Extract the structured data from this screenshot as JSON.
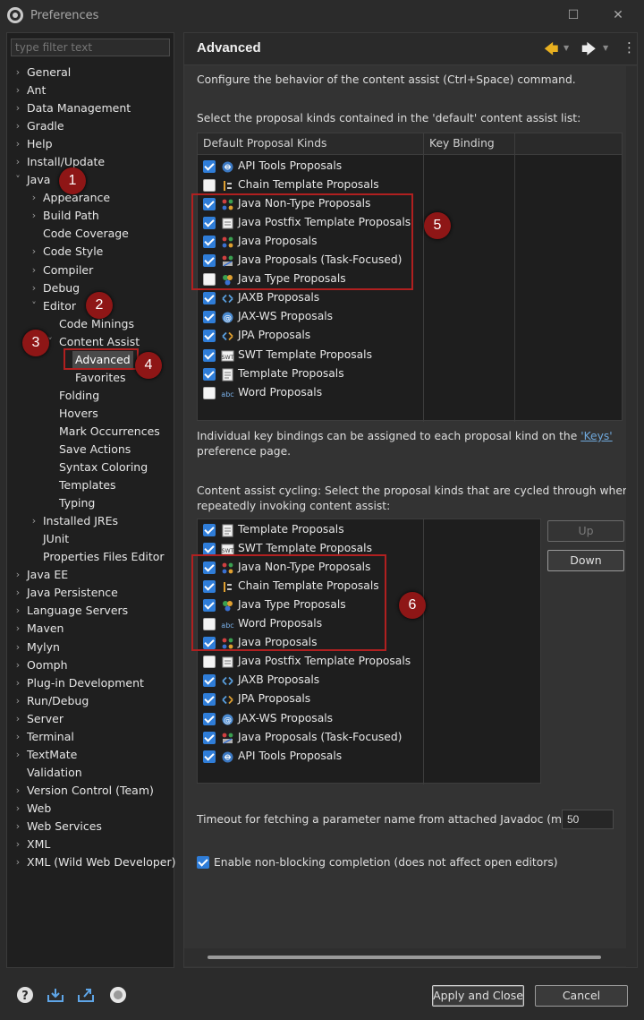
{
  "window": {
    "title": "Preferences",
    "maximize_glyph": "☐",
    "close_glyph": "✕"
  },
  "filter": {
    "placeholder": "type filter text"
  },
  "tree": [
    {
      "label": "General",
      "level": 0,
      "chevron": ">",
      "selected": false
    },
    {
      "label": "Ant",
      "level": 0,
      "chevron": ">",
      "selected": false
    },
    {
      "label": "Data Management",
      "level": 0,
      "chevron": ">",
      "selected": false
    },
    {
      "label": "Gradle",
      "level": 0,
      "chevron": ">",
      "selected": false
    },
    {
      "label": "Help",
      "level": 0,
      "chevron": ">",
      "selected": false
    },
    {
      "label": "Install/Update",
      "level": 0,
      "chevron": ">",
      "selected": false
    },
    {
      "label": "Java",
      "level": 0,
      "chevron": "v",
      "selected": false
    },
    {
      "label": "Appearance",
      "level": 1,
      "chevron": ">",
      "selected": false
    },
    {
      "label": "Build Path",
      "level": 1,
      "chevron": ">",
      "selected": false
    },
    {
      "label": "Code Coverage",
      "level": 1,
      "chevron": "",
      "selected": false
    },
    {
      "label": "Code Style",
      "level": 1,
      "chevron": ">",
      "selected": false
    },
    {
      "label": "Compiler",
      "level": 1,
      "chevron": ">",
      "selected": false
    },
    {
      "label": "Debug",
      "level": 1,
      "chevron": ">",
      "selected": false
    },
    {
      "label": "Editor",
      "level": 1,
      "chevron": "v",
      "selected": false
    },
    {
      "label": "Code Minings",
      "level": 2,
      "chevron": "",
      "selected": false
    },
    {
      "label": "Content Assist",
      "level": 2,
      "chevron": "v",
      "selected": false
    },
    {
      "label": "Advanced",
      "level": 3,
      "chevron": "",
      "selected": true
    },
    {
      "label": "Favorites",
      "level": 3,
      "chevron": "",
      "selected": false
    },
    {
      "label": "Folding",
      "level": 2,
      "chevron": "",
      "selected": false
    },
    {
      "label": "Hovers",
      "level": 2,
      "chevron": "",
      "selected": false
    },
    {
      "label": "Mark Occurrences",
      "level": 2,
      "chevron": "",
      "selected": false
    },
    {
      "label": "Save Actions",
      "level": 2,
      "chevron": "",
      "selected": false
    },
    {
      "label": "Syntax Coloring",
      "level": 2,
      "chevron": "",
      "selected": false
    },
    {
      "label": "Templates",
      "level": 2,
      "chevron": "",
      "selected": false
    },
    {
      "label": "Typing",
      "level": 2,
      "chevron": "",
      "selected": false
    },
    {
      "label": "Installed JREs",
      "level": 1,
      "chevron": ">",
      "selected": false
    },
    {
      "label": "JUnit",
      "level": 1,
      "chevron": "",
      "selected": false
    },
    {
      "label": "Properties Files Editor",
      "level": 1,
      "chevron": "",
      "selected": false
    },
    {
      "label": "Java EE",
      "level": 0,
      "chevron": ">",
      "selected": false
    },
    {
      "label": "Java Persistence",
      "level": 0,
      "chevron": ">",
      "selected": false
    },
    {
      "label": "Language Servers",
      "level": 0,
      "chevron": ">",
      "selected": false
    },
    {
      "label": "Maven",
      "level": 0,
      "chevron": ">",
      "selected": false
    },
    {
      "label": "Mylyn",
      "level": 0,
      "chevron": ">",
      "selected": false
    },
    {
      "label": "Oomph",
      "level": 0,
      "chevron": ">",
      "selected": false
    },
    {
      "label": "Plug-in Development",
      "level": 0,
      "chevron": ">",
      "selected": false
    },
    {
      "label": "Run/Debug",
      "level": 0,
      "chevron": ">",
      "selected": false
    },
    {
      "label": "Server",
      "level": 0,
      "chevron": ">",
      "selected": false
    },
    {
      "label": "Terminal",
      "level": 0,
      "chevron": ">",
      "selected": false
    },
    {
      "label": "TextMate",
      "level": 0,
      "chevron": ">",
      "selected": false
    },
    {
      "label": "Validation",
      "level": 0,
      "chevron": "",
      "selected": false
    },
    {
      "label": "Version Control (Team)",
      "level": 0,
      "chevron": ">",
      "selected": false
    },
    {
      "label": "Web",
      "level": 0,
      "chevron": ">",
      "selected": false
    },
    {
      "label": "Web Services",
      "level": 0,
      "chevron": ">",
      "selected": false
    },
    {
      "label": "XML",
      "level": 0,
      "chevron": ">",
      "selected": false
    },
    {
      "label": "XML (Wild Web Developer)",
      "level": 0,
      "chevron": ">",
      "selected": false
    }
  ],
  "page": {
    "title": "Advanced",
    "description": "Configure the behavior of the content assist (Ctrl+Space) command.",
    "default_list_label": "Select the proposal kinds contained in the 'default' content assist list:",
    "col_kinds": "Default Proposal Kinds",
    "col_binding": "Key Binding",
    "default_kinds": [
      {
        "label": "API Tools Proposals",
        "checked": true,
        "icon": "api-tools-icon"
      },
      {
        "label": "Chain Template Proposals",
        "checked": false,
        "icon": "chain-template-icon"
      },
      {
        "label": "Java Non-Type Proposals",
        "checked": true,
        "icon": "java-non-type-icon"
      },
      {
        "label": "Java Postfix Template Proposals",
        "checked": true,
        "icon": "postfix-template-icon"
      },
      {
        "label": "Java Proposals",
        "checked": true,
        "icon": "java-proposals-icon"
      },
      {
        "label": "Java Proposals (Task-Focused)",
        "checked": true,
        "icon": "task-focused-icon"
      },
      {
        "label": "Java Type Proposals",
        "checked": false,
        "icon": "java-type-icon"
      },
      {
        "label": "JAXB Proposals",
        "checked": true,
        "icon": "jaxb-icon"
      },
      {
        "label": "JAX-WS Proposals",
        "checked": true,
        "icon": "jax-ws-icon"
      },
      {
        "label": "JPA Proposals",
        "checked": true,
        "icon": "jpa-icon"
      },
      {
        "label": "SWT Template Proposals",
        "checked": true,
        "icon": "swt-template-icon"
      },
      {
        "label": "Template Proposals",
        "checked": true,
        "icon": "template-icon"
      },
      {
        "label": "Word Proposals",
        "checked": false,
        "icon": "word-icon"
      }
    ],
    "keys_note_prefix": "Individual key bindings can be assigned to each proposal kind on the ",
    "keys_link": "'Keys'",
    "keys_note_suffix": "preference page.",
    "cycling_label_1": "Content assist cycling: Select the proposal kinds that are cycled through when",
    "cycling_label_2": "repeatedly invoking content assist:",
    "cycling_kinds": [
      {
        "label": "Template Proposals",
        "checked": true,
        "icon": "template-icon"
      },
      {
        "label": "SWT Template Proposals",
        "checked": true,
        "icon": "swt-template-icon"
      },
      {
        "label": "Java Non-Type Proposals",
        "checked": true,
        "icon": "java-non-type-icon"
      },
      {
        "label": "Chain Template Proposals",
        "checked": true,
        "icon": "chain-template-icon"
      },
      {
        "label": "Java Type Proposals",
        "checked": true,
        "icon": "java-type-icon"
      },
      {
        "label": "Word Proposals",
        "checked": false,
        "icon": "word-icon"
      },
      {
        "label": "Java Proposals",
        "checked": true,
        "icon": "java-proposals-icon"
      },
      {
        "label": "Java Postfix Template Proposals",
        "checked": false,
        "icon": "postfix-template-icon"
      },
      {
        "label": "JAXB Proposals",
        "checked": true,
        "icon": "jaxb-icon"
      },
      {
        "label": "JPA Proposals",
        "checked": true,
        "icon": "jpa-icon"
      },
      {
        "label": "JAX-WS Proposals",
        "checked": true,
        "icon": "jax-ws-icon"
      },
      {
        "label": "Java Proposals (Task-Focused)",
        "checked": true,
        "icon": "task-focused-icon"
      },
      {
        "label": "API Tools Proposals",
        "checked": true,
        "icon": "api-tools-icon"
      }
    ],
    "up_label": "Up",
    "down_label": "Down",
    "timeout_label": "Timeout for fetching a parameter name from attached Javadoc (ms):",
    "timeout_value": "50",
    "nonblocking_label": "Enable non-blocking completion (does not affect open editors)",
    "nonblocking_checked": true
  },
  "annotations": [
    "1",
    "2",
    "3",
    "4",
    "5",
    "6"
  ],
  "footer": {
    "apply_close": "Apply and Close",
    "cancel": "Cancel"
  },
  "colors": {
    "accent": "#2f7dd8",
    "highlight_red": "#b02020",
    "badge_red": "#8e1616",
    "back_arrow": "#e8b020"
  }
}
